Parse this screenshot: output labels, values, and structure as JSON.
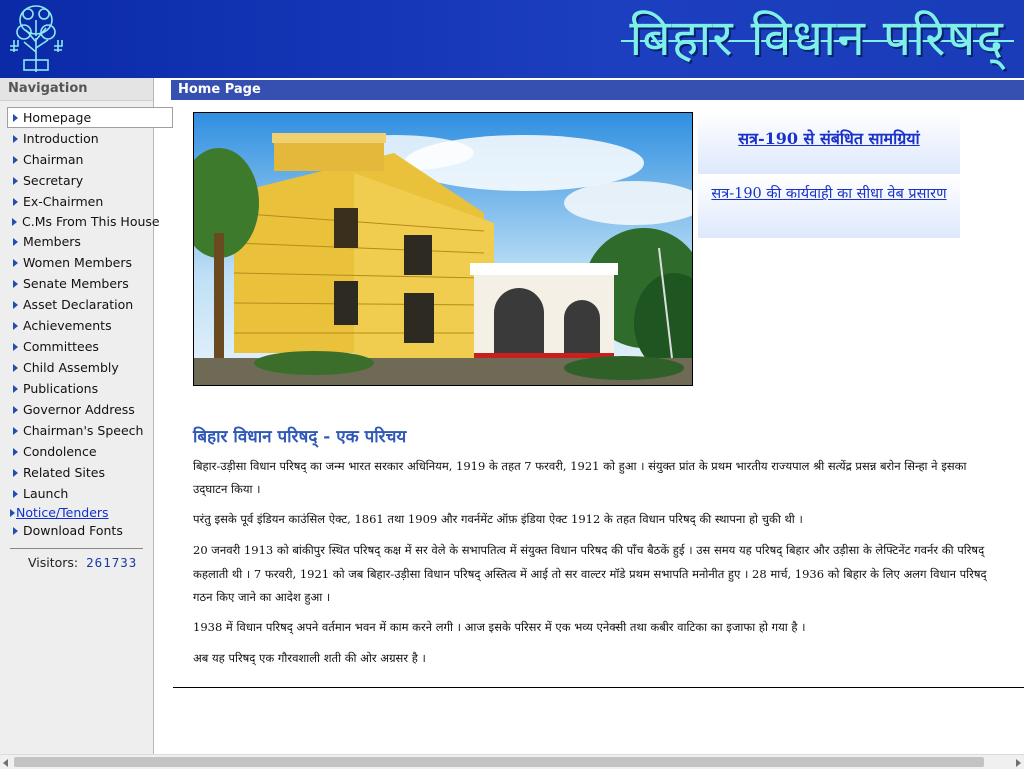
{
  "header": {
    "site_title": "बिहार विधान परिषद्"
  },
  "sidebar": {
    "heading": "Navigation",
    "items": [
      {
        "label": "Homepage"
      },
      {
        "label": "Introduction"
      },
      {
        "label": "Chairman"
      },
      {
        "label": "Secretary"
      },
      {
        "label": "Ex-Chairmen"
      },
      {
        "label": "C.Ms From This House"
      },
      {
        "label": "Members"
      },
      {
        "label": "Women Members"
      },
      {
        "label": "Senate Members"
      },
      {
        "label": "Asset Declaration"
      },
      {
        "label": "Achievements"
      },
      {
        "label": "Committees"
      },
      {
        "label": "Child Assembly"
      },
      {
        "label": "Publications"
      },
      {
        "label": "Governor Address"
      },
      {
        "label": "Chairman's Speech"
      },
      {
        "label": "Condolence"
      },
      {
        "label": "Related Sites"
      },
      {
        "label": "Launch"
      },
      {
        "label": "Notice/Tenders"
      },
      {
        "label": "Download Fonts"
      }
    ],
    "visitors_label": "Visitors:",
    "visitors_count": "261733"
  },
  "main": {
    "bar_title": "Home Page",
    "links": [
      {
        "label": "सत्र-190 से संबंधित सामग्रियां"
      },
      {
        "label": "सत्र-190 की कार्यवाही का सीधा वेब प्रसारण"
      }
    ],
    "section_title": "बिहार विधान परिषद् - एक परिचय",
    "paragraphs": [
      "बिहार-उड़ीसा विधान परिषद् का जन्म भारत सरकार अधिनियम, 1919 के तहत 7 फरवरी, 1921 को हुआ । संयुक्त प्रांत के प्रथम भारतीय राज्यपाल श्री सत्येंद्र प्रसन्न बरोन सिन्हा ने इसका",
      "उद्‌घाटन किया ।",
      "परंतु इसके पूर्व इंडियन काउंसिल ऐक्ट, 1861 तथा 1909 और गवर्नमेंट ऑफ़ इंडिया ऐक्ट 1912 के तहत विधान परिषद् की स्थापना हो चुकी थी ।",
      "20 जनवरी 1913 को बांकीपुर स्थित परिषद् कक्ष में सर वेले के सभापतित्व में संयुक्त विधान परिषद की पाँच बैठकें हुई । उस समय यह परिषद् बिहार और उड़ीसा के लेफ्टिनेंट गवर्नर की परिषद्",
      "कहलाती थी । 7 फरवरी, 1921 को जब बिहार-उड़ीसा विधान परिषद् अस्तित्व में आई तो सर वाल्टर मॉडे प्रथम सभापति मनोनीत हुए । 28 मार्च, 1936 को बिहार के लिए अलग विधान परिषद्",
      "गठन किए जाने का आदेश हुआ ।",
      "1938 में विधान परिषद् अपने वर्तमान भवन में काम करने लगी । आज इसके परिसर में एक भव्य एनेक्सी तथा कबीर वाटिका का इजाफा हो गया है ।",
      "अब यह परिषद् एक गौरवशाली शती की ओर अग्रसर है ।"
    ]
  },
  "colors": {
    "header_blue": "#1a3cb8",
    "title_cyan": "#7ff0e8",
    "bar_blue": "#3550b0",
    "link_blue": "#1a32c8",
    "section_title_blue": "#2f58b8"
  }
}
